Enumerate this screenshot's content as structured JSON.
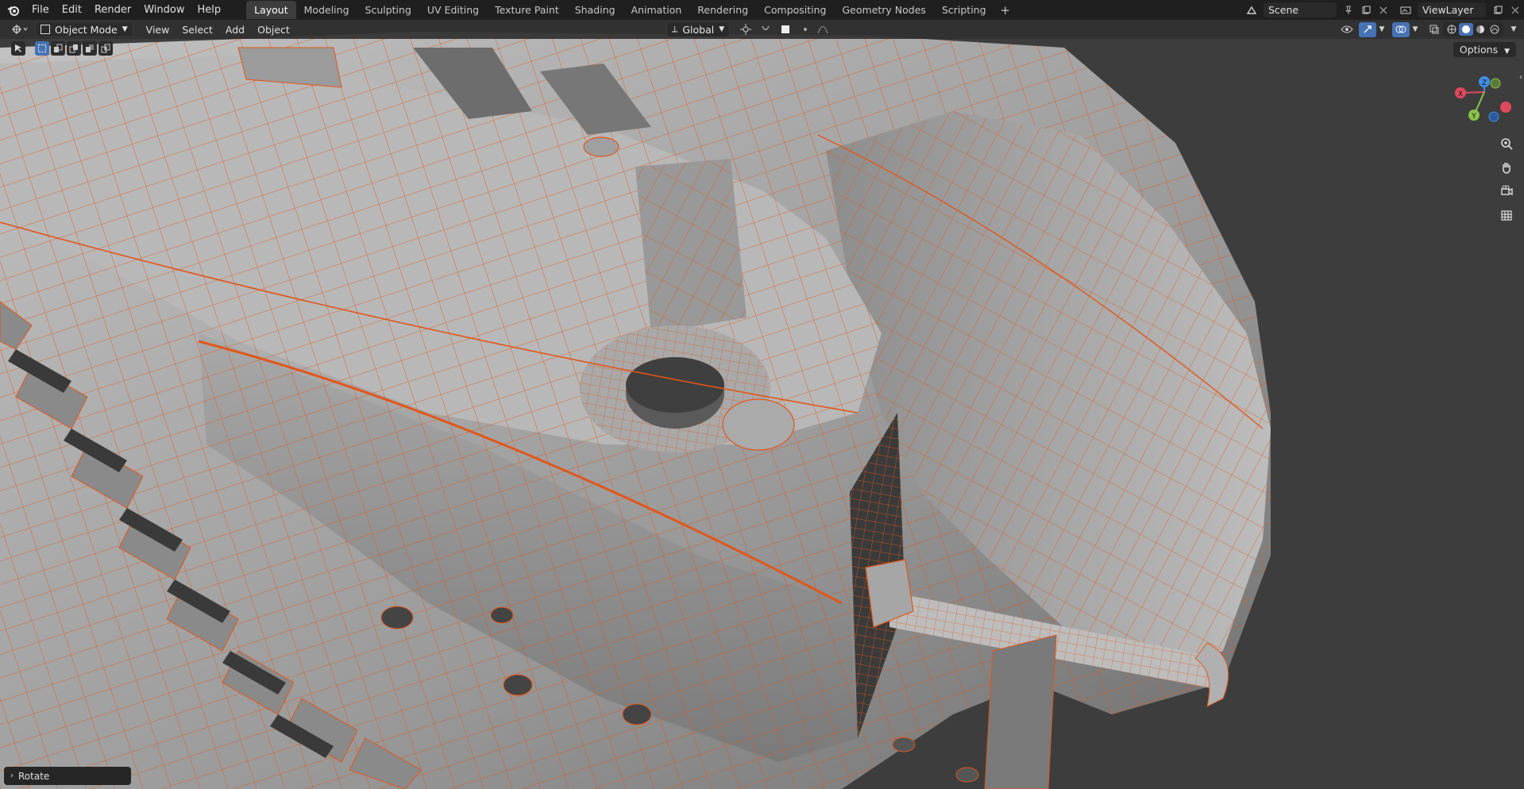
{
  "topbar": {
    "menus": [
      "File",
      "Edit",
      "Render",
      "Window",
      "Help"
    ],
    "workspace_tabs": [
      "Layout",
      "Modeling",
      "Sculpting",
      "UV Editing",
      "Texture Paint",
      "Shading",
      "Animation",
      "Rendering",
      "Compositing",
      "Geometry Nodes",
      "Scripting"
    ],
    "active_tab": "Layout",
    "add_tab_symbol": "+",
    "scene_name": "Scene",
    "view_layer": "ViewLayer"
  },
  "header": {
    "mode": "Object Mode",
    "menus": [
      "View",
      "Select",
      "Add",
      "Object"
    ],
    "transform_orientation": "Global",
    "options_label": "Options"
  },
  "gizmo": {
    "x_label": "X",
    "y_label": "Y",
    "z_label": "Z"
  },
  "colors": {
    "background": "#3d3d3d",
    "wire": "#e0561a",
    "mesh_light": "#b4b4b4",
    "mesh_dark": "#6a6a6a",
    "axis_x": "#e04a5f",
    "axis_y": "#8bc34a",
    "axis_z": "#3f8ee8",
    "accent": "#4772b3"
  },
  "icons": [
    "blender-logo",
    "scene-icon",
    "viewlayer-icon",
    "select-box-icon",
    "gizmo-icon",
    "overlay-icon",
    "zoom-icon",
    "hand-icon",
    "camera-icon",
    "grid-icon"
  ],
  "operator_panel": {
    "label": "Rotate"
  }
}
